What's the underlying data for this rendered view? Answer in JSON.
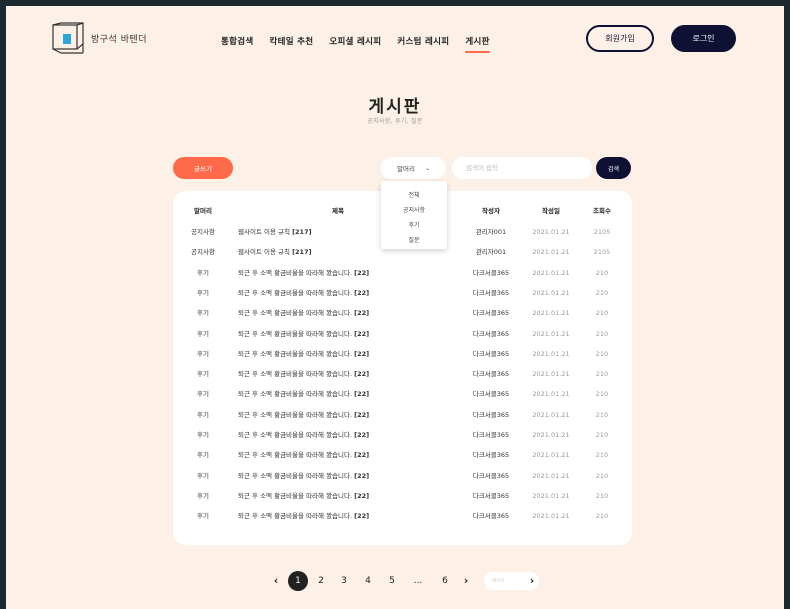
{
  "header": {
    "logo_text": "방구석 바텐더",
    "nav": [
      "통합검색",
      "칵테일 추천",
      "오피셜 레시피",
      "커스텀 레시피",
      "게시판"
    ],
    "active_nav": "게시판",
    "signup_label": "회원가입",
    "login_label": "로그인"
  },
  "main": {
    "title": "게시판",
    "subtitle": "공지사항, 후기, 질문"
  },
  "toolbar": {
    "write_label": "글쓰기",
    "category_selected": "말머리",
    "search_placeholder": "검색어 입력",
    "search_label": "검색"
  },
  "dropdown": {
    "options": [
      "전체",
      "공지사항",
      "후기",
      "질문"
    ]
  },
  "table": {
    "headers": [
      "말머리",
      "제목",
      "작성자",
      "작성일",
      "조회수"
    ],
    "rows": [
      {
        "cat": "공지사항",
        "title": "웹사이트 이용 규칙",
        "count": "[217]",
        "author": "관리자001",
        "date": "2021.01.21",
        "views": "2105"
      },
      {
        "cat": "공지사항",
        "title": "웹사이트 이용 규칙",
        "count": "[217]",
        "author": "관리자001",
        "date": "2021.01.21",
        "views": "2105"
      },
      {
        "cat": "후기",
        "title": "퇴근 후 소맥 황금비율을 따라해 봤습니다.",
        "count": "[22]",
        "author": "다크서클365",
        "date": "2021.01.21",
        "views": "210"
      },
      {
        "cat": "후기",
        "title": "퇴근 후 소맥 황금비율을 따라해 봤습니다.",
        "count": "[22]",
        "author": "다크서클365",
        "date": "2021.01.21",
        "views": "210"
      },
      {
        "cat": "후기",
        "title": "퇴근 후 소맥 황금비율을 따라해 봤습니다.",
        "count": "[22]",
        "author": "다크서클365",
        "date": "2021.01.21",
        "views": "210"
      },
      {
        "cat": "후기",
        "title": "퇴근 후 소맥 황금비율을 따라해 봤습니다.",
        "count": "[22]",
        "author": "다크서클365",
        "date": "2021.01.21",
        "views": "210"
      },
      {
        "cat": "후기",
        "title": "퇴근 후 소맥 황금비율을 따라해 봤습니다.",
        "count": "[22]",
        "author": "다크서클365",
        "date": "2021.01.21",
        "views": "210"
      },
      {
        "cat": "후기",
        "title": "퇴근 후 소맥 황금비율을 따라해 봤습니다.",
        "count": "[22]",
        "author": "다크서클365",
        "date": "2021.01.21",
        "views": "210"
      },
      {
        "cat": "후기",
        "title": "퇴근 후 소맥 황금비율을 따라해 봤습니다.",
        "count": "[22]",
        "author": "다크서클365",
        "date": "2021.01.21",
        "views": "210"
      },
      {
        "cat": "후기",
        "title": "퇴근 후 소맥 황금비율을 따라해 봤습니다.",
        "count": "[22]",
        "author": "다크서클365",
        "date": "2021.01.21",
        "views": "210"
      },
      {
        "cat": "후기",
        "title": "퇴근 후 소맥 황금비율을 따라해 봤습니다.",
        "count": "[22]",
        "author": "다크서클365",
        "date": "2021.01.21",
        "views": "210"
      },
      {
        "cat": "후기",
        "title": "퇴근 후 소맥 황금비율을 따라해 봤습니다.",
        "count": "[22]",
        "author": "다크서클365",
        "date": "2021.01.21",
        "views": "210"
      },
      {
        "cat": "후기",
        "title": "퇴근 후 소맥 황금비율을 따라해 봤습니다.",
        "count": "[22]",
        "author": "다크서클365",
        "date": "2021.01.21",
        "views": "210"
      },
      {
        "cat": "후기",
        "title": "퇴근 후 소맥 황금비율을 따라해 봤습니다.",
        "count": "[22]",
        "author": "다크서클365",
        "date": "2021.01.21",
        "views": "210"
      },
      {
        "cat": "후기",
        "title": "퇴근 후 소맥 황금비율을 따라해 봤습니다.",
        "count": "[22]",
        "author": "다크서클365",
        "date": "2021.01.21",
        "views": "210"
      }
    ]
  },
  "pagination": {
    "prev_icon": "chevron-left-icon",
    "pages": [
      "1",
      "2",
      "3",
      "4",
      "5",
      "...",
      "6"
    ],
    "current": "1",
    "next_icon": "chevron-right-icon",
    "goto_placeholder": "페이지",
    "goto_icon": "chevron-right-icon"
  },
  "colors": {
    "background": "#fdf1e7",
    "accent": "#ff6b4a",
    "navy": "#0e1133",
    "frame": "#1c2a30"
  }
}
